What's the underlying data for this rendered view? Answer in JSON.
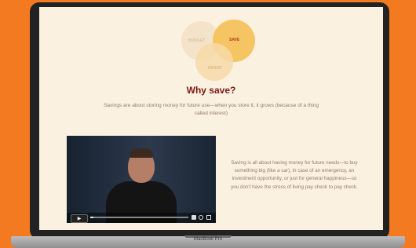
{
  "venn": {
    "budget_label": "BUDGET",
    "save_label": "SAVE",
    "invest_label": "INVEST"
  },
  "main": {
    "heading": "Why save?",
    "subtext": "Savings are about storing money for future use—when you store it, it grows (because of a thing called interest)",
    "side_text": "Saving is all about having money for future needs—to buy something big (like a car), in case of an emergency, an investment opportunity, or just for general happiness—so you don't have the stress of living pay check to pay check."
  },
  "video": {
    "progress": 0.03
  },
  "device": {
    "label": "MacBook Pro"
  },
  "colors": {
    "background": "#f47a22",
    "page": "#fbf1e1",
    "heading": "#7a1a13",
    "accent": "#f5c25c"
  },
  "icons": [
    "play-icon",
    "volume-icon",
    "settings-icon",
    "fullscreen-icon"
  ]
}
